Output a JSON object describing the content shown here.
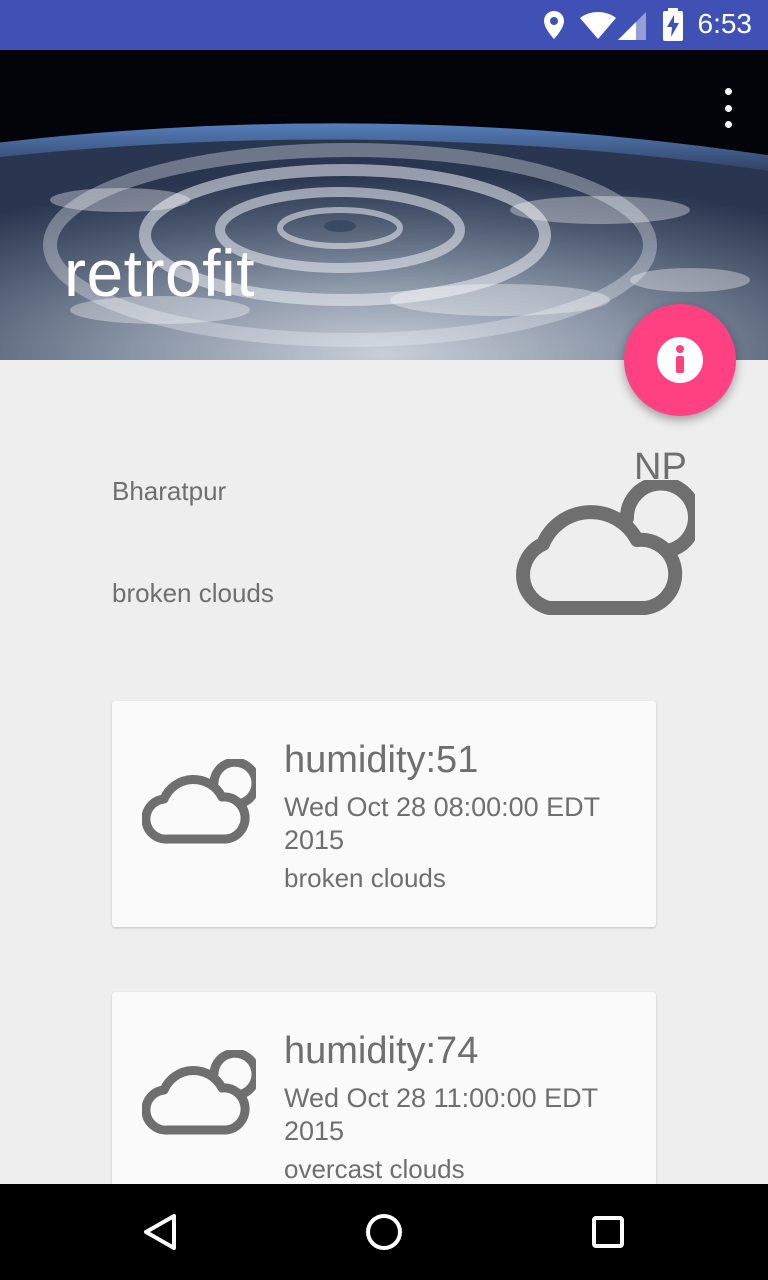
{
  "status_bar": {
    "time": "6:53",
    "icons": [
      "location-icon",
      "wifi-icon",
      "signal-icon",
      "battery-charging-icon"
    ]
  },
  "toolbar": {
    "title": "retrofit",
    "menu_icon": "more-vert-icon"
  },
  "fab": {
    "icon": "info-icon",
    "color": "#ff4081"
  },
  "current": {
    "country": "NP",
    "city": "Bharatpur",
    "description": "broken clouds",
    "icon": "cloud-icon"
  },
  "forecast": [
    {
      "humidity": "humidity:51",
      "date": "Wed Oct 28 08:00:00 EDT 2015",
      "description": "broken clouds",
      "icon": "cloud-icon"
    },
    {
      "humidity": "humidity:74",
      "date": "Wed Oct 28 11:00:00 EDT 2015",
      "description": "overcast clouds",
      "icon": "cloud-icon"
    }
  ],
  "nav": {
    "back": "back-icon",
    "home": "home-icon",
    "recents": "recents-icon"
  },
  "colors": {
    "primary": "#3f51b5",
    "accent": "#ff4081",
    "background": "#eeeeee",
    "card": "#fafafa",
    "text": "#6f6f6f"
  }
}
